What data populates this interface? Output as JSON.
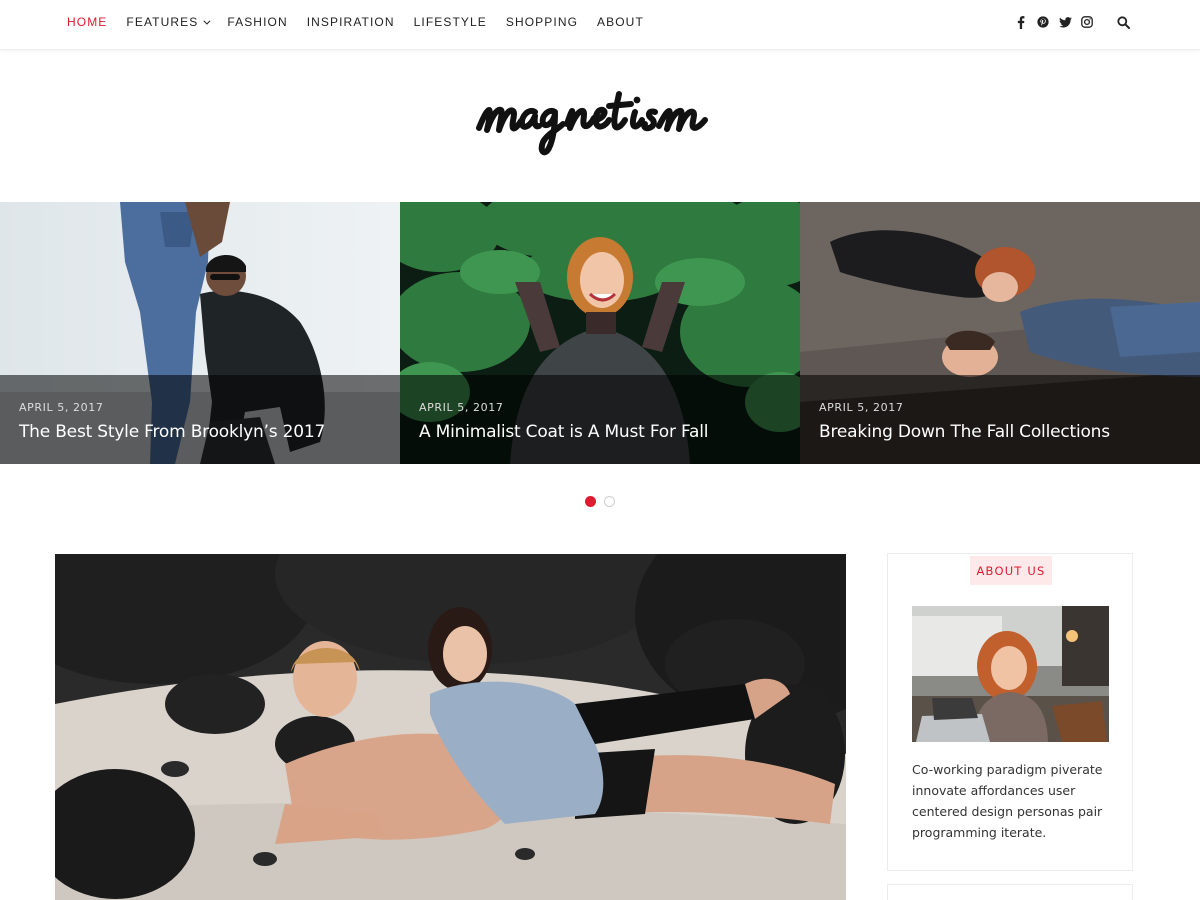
{
  "nav": {
    "items": [
      {
        "label": "HOME",
        "active": true
      },
      {
        "label": "FEATURES",
        "has_dropdown": true
      },
      {
        "label": "FASHION"
      },
      {
        "label": "INSPIRATION"
      },
      {
        "label": "LIFESTYLE"
      },
      {
        "label": "SHOPPING"
      },
      {
        "label": "ABOUT"
      }
    ],
    "social_icons": [
      "facebook-icon",
      "pinterest-icon",
      "twitter-icon",
      "instagram-icon"
    ],
    "search_icon": "search-icon"
  },
  "logo": {
    "text": "magnetism"
  },
  "slider": {
    "slides": [
      {
        "date": "APRIL 5, 2017",
        "title": "The Best Style From Brooklyn’s 2017"
      },
      {
        "date": "APRIL 5, 2017",
        "title": "A Minimalist Coat is A Must For Fall"
      },
      {
        "date": "APRIL 5, 2017",
        "title": "Breaking Down The Fall Collections"
      }
    ],
    "pages": 2,
    "active_page": 1
  },
  "sidebar": {
    "about": {
      "title": "ABOUT US",
      "text": "Co-working paradigm piverate innovate affordances user centered design personas pair programming iterate."
    }
  },
  "colors": {
    "accent": "#e01a2f",
    "accent_bg": "#fde8ea"
  }
}
